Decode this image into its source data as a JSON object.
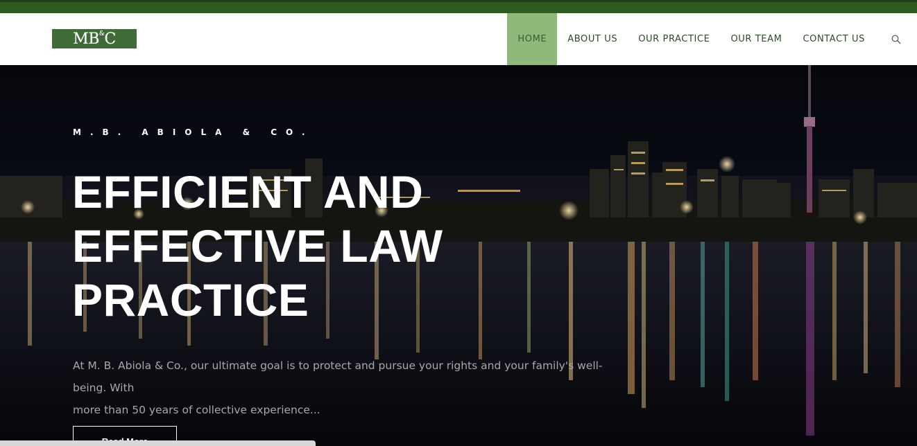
{
  "brand": {
    "logo_text": "MB&C",
    "logo_prefix": "MB",
    "logo_amp": "&",
    "logo_suffix": "C"
  },
  "nav": {
    "items": [
      {
        "label": "HOME",
        "active": true
      },
      {
        "label": "ABOUT US"
      },
      {
        "label": "OUR PRACTICE"
      },
      {
        "label": "OUR TEAM"
      },
      {
        "label": "CONTACT US"
      }
    ],
    "search_icon": "search-icon"
  },
  "hero": {
    "eyebrow": "M.B. ABIOLA & CO.",
    "headline_line1": "EFFICIENT AND",
    "headline_line2": "EFFECTIVE LAW",
    "headline_line3": "PRACTICE",
    "lead_line1": "At M. B. Abiola & Co., our ultimate goal is to protect and pursue your rights and your family's well-being. With",
    "lead_line2": "more than 50 years of collective experience...",
    "cta_label": "Read More"
  },
  "colors": {
    "top_stripe": "#2f5b1f",
    "logo_bg": "#3e6b36",
    "nav_active_bg": "#8fb87a",
    "nav_text": "#2d4a2b"
  }
}
